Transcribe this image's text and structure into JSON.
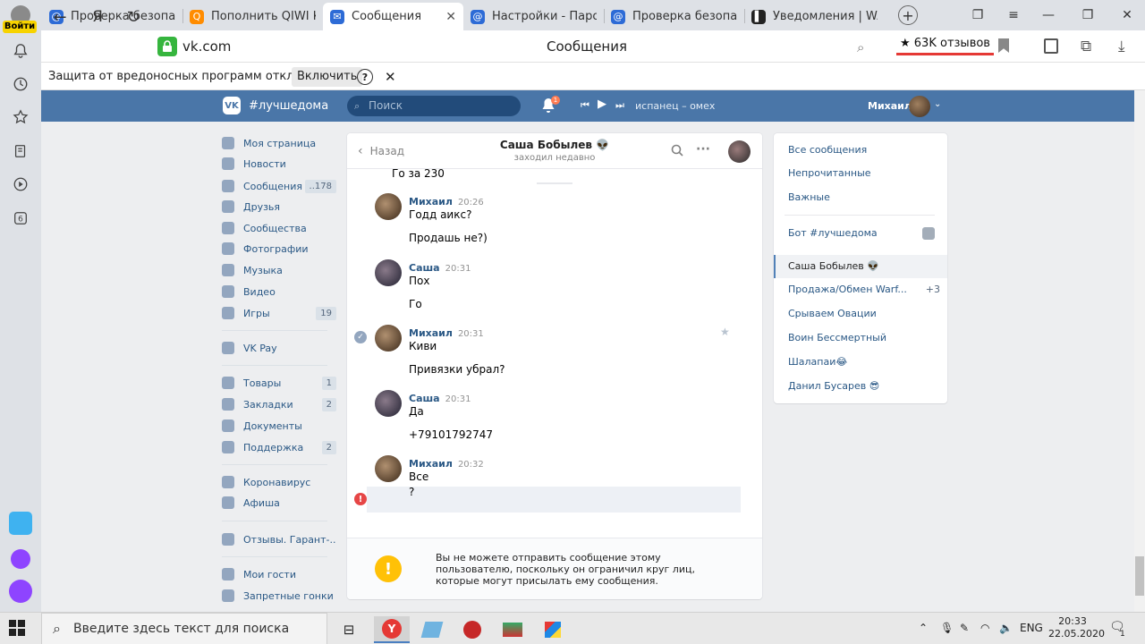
{
  "browser": {
    "login_label": "Войти",
    "tabs": [
      {
        "title": "Проверка безопасн",
        "fav_color": "#2d6bd6",
        "fav_glyph": "@"
      },
      {
        "title": "Пополнить QIWI Ко",
        "fav_color": "#ff8c00",
        "fav_glyph": "Q"
      },
      {
        "title": "Сообщения",
        "fav_color": "#2d6bd6",
        "fav_glyph": "✉",
        "active": true
      },
      {
        "title": "Настройки - Пароль",
        "fav_color": "#2d6bd6",
        "fav_glyph": "@"
      },
      {
        "title": "Проверка безопасн",
        "fav_color": "#2d6bd6",
        "fav_glyph": "@"
      },
      {
        "title": "Уведомления | WARI",
        "fav_color": "#222222",
        "fav_glyph": "▌"
      }
    ],
    "close_tab": "✕",
    "new_tab": "+",
    "url": "vk.com",
    "page_title": "Сообщения",
    "reviews": "★ 63K отзывов",
    "rail_badge": "6",
    "infobar": {
      "text": "Защита от вредоносных программ отключена",
      "button": "Включить",
      "help": "?",
      "close": "✕"
    }
  },
  "vk": {
    "logo": "VK",
    "hashtag": "#лучшедома",
    "search_placeholder": "Поиск",
    "notif_count": "1",
    "track": "испанец – омех",
    "user": "Михаил",
    "menu": [
      {
        "label": "Моя страница",
        "count": ""
      },
      {
        "label": "Новости",
        "count": ""
      },
      {
        "label": "Сообщения",
        "count": "..178"
      },
      {
        "label": "Друзья",
        "count": ""
      },
      {
        "label": "Сообщества",
        "count": ""
      },
      {
        "label": "Фотографии",
        "count": ""
      },
      {
        "label": "Музыка",
        "count": ""
      },
      {
        "label": "Видео",
        "count": ""
      },
      {
        "label": "Игры",
        "count": "19"
      },
      {
        "label": "VK Pay",
        "count": ""
      },
      {
        "label": "Товары",
        "count": "1"
      },
      {
        "label": "Закладки",
        "count": "2"
      },
      {
        "label": "Документы",
        "count": ""
      },
      {
        "label": "Поддержка",
        "count": "2"
      },
      {
        "label": "Коронавирус",
        "count": ""
      },
      {
        "label": "Афиша",
        "count": ""
      },
      {
        "label": "Отзывы. Гарант-..",
        "count": ""
      },
      {
        "label": "Мои гости",
        "count": ""
      },
      {
        "label": "Запретные гонки",
        "count": ""
      }
    ],
    "chat": {
      "back": "Назад",
      "name": "Саша Бобылев 👽",
      "status": "заходил недавно",
      "partial_top": "Го за 230",
      "messages": [
        {
          "author": "Михаил",
          "time": "20:26",
          "lines": [
            "Годд аикс?",
            "Продашь не?)"
          ],
          "who": "m"
        },
        {
          "author": "Саша",
          "time": "20:31",
          "lines": [
            "Пох",
            "Го"
          ],
          "who": "s"
        },
        {
          "author": "Михаил",
          "time": "20:31",
          "lines": [
            "Киви",
            "Привязки убрал?"
          ],
          "who": "m"
        },
        {
          "author": "Саша",
          "time": "20:31",
          "lines": [
            "Да",
            "+79101792747"
          ],
          "who": "s"
        },
        {
          "author": "Михаил",
          "time": "20:32",
          "lines": [
            "Все",
            "?"
          ],
          "who": "m"
        }
      ],
      "warning": "Вы не можете отправить сообщение этому пользователю, поскольку он ограничил круг лиц, которые могут присылать ему сообщения."
    },
    "right_panel": {
      "filters": [
        "Все сообщения",
        "Непрочитанные",
        "Важные"
      ],
      "bot": "Бот #лучшедома",
      "convs": [
        {
          "name": "Саша Бобылев 👽",
          "count": ""
        },
        {
          "name": "Продажа/Обмен Warf...",
          "count": "+3"
        },
        {
          "name": "Срываем Овации",
          "count": ""
        },
        {
          "name": "Воин Бессмертный",
          "count": ""
        },
        {
          "name": "Шалапаи😂",
          "count": ""
        },
        {
          "name": "Данил Бусарев 😎",
          "count": ""
        }
      ]
    }
  },
  "taskbar": {
    "search_placeholder": "Введите здесь текст для поиска",
    "lang": "ENG",
    "time": "20:33",
    "date": "22.05.2020",
    "notif": "1"
  },
  "colors": {
    "vk_blue": "#4a76a8",
    "link": "#2a5885",
    "warning": "#ffc107",
    "error": "#e64646"
  }
}
